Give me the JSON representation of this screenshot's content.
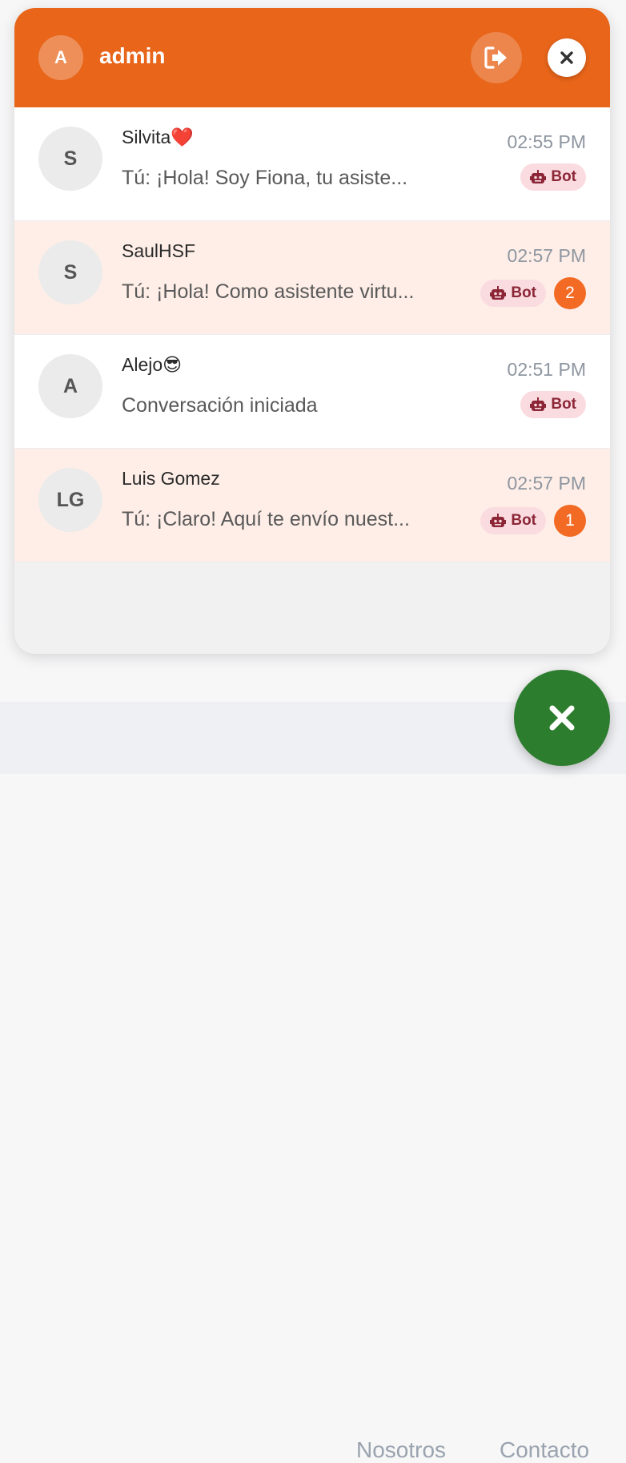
{
  "header": {
    "avatar_initial": "A",
    "username": "admin",
    "accent_color": "#e8651a"
  },
  "conversations": [
    {
      "initials": "S",
      "name": "Silvita❤️",
      "preview": "Tú: ¡Hola! Soy Fiona, tu asiste...",
      "time": "02:55 PM",
      "badge": "Bot",
      "unread": ""
    },
    {
      "initials": "S",
      "name": "SaulHSF",
      "preview": "Tú: ¡Hola! Como asistente virtu...",
      "time": "02:57 PM",
      "badge": "Bot",
      "unread": "2"
    },
    {
      "initials": "A",
      "name": "Alejo😎",
      "preview": "Conversación iniciada",
      "time": "02:51 PM",
      "badge": "Bot",
      "unread": ""
    },
    {
      "initials": "LG",
      "name": "Luis Gomez",
      "preview": "Tú: ¡Claro! Aquí te envío nuest...",
      "time": "02:57 PM",
      "badge": "Bot",
      "unread": "1"
    }
  ],
  "footer": {
    "links": [
      "Nosotros",
      "Contacto"
    ]
  },
  "icons": {
    "logout": "logout-icon",
    "close": "close-icon",
    "bot": "robot-icon",
    "fab": "close-icon"
  },
  "colors": {
    "fab": "#2d7d2f",
    "unread_row": "#feeee7",
    "unread_badge": "#f26a24",
    "bot_badge_bg": "#fadbe0",
    "bot_badge_text": "#8c2637"
  }
}
